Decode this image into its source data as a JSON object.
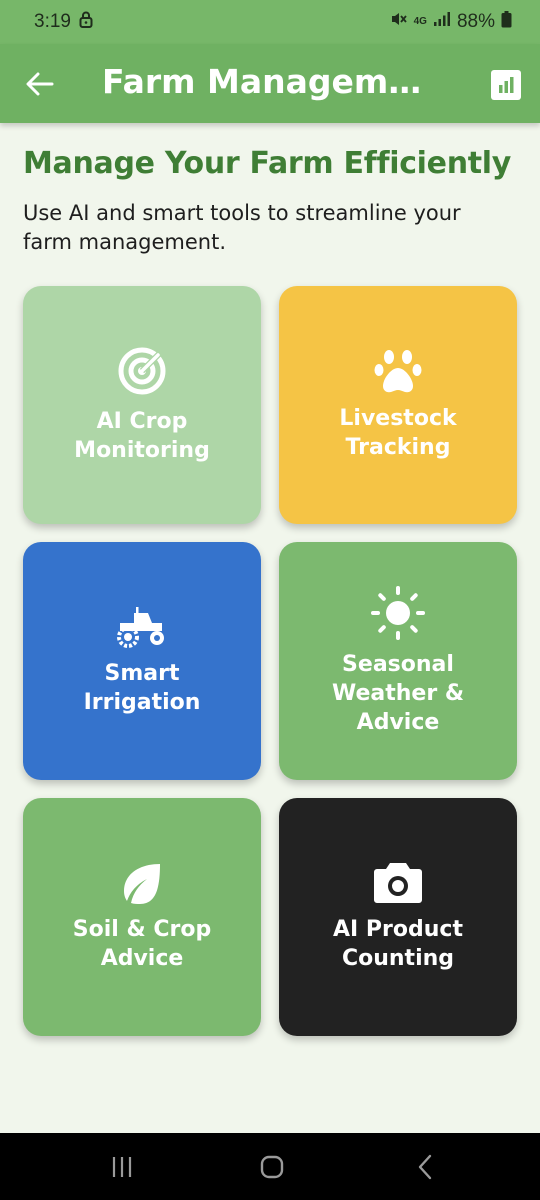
{
  "status_bar": {
    "time": "3:19",
    "network": "4G",
    "battery": "88%"
  },
  "app_bar": {
    "title": "Farm Management"
  },
  "headline": "Manage Your Farm Efficiently",
  "subtitle": "Use AI and smart tools to streamline your farm management.",
  "cards": [
    {
      "label": "AI Crop\nMonitoring",
      "icon": "radar-icon",
      "color": "#aed6a7"
    },
    {
      "label": "Livestock\nTracking",
      "icon": "paw-icon",
      "color": "#f5c445"
    },
    {
      "label": "Smart Irrigation",
      "icon": "tractor-icon",
      "color": "#3573cc"
    },
    {
      "label": "Seasonal\nWeather &\nAdvice",
      "icon": "sun-icon",
      "color": "#7cb96f"
    },
    {
      "label": "Soil & Crop\nAdvice",
      "icon": "leaf-icon",
      "color": "#7cb96f"
    },
    {
      "label": "AI Product\nCounting",
      "icon": "camera-icon",
      "color": "#222222"
    }
  ],
  "colors": {
    "app_bar": "#6fb162",
    "headline": "#3f7e35",
    "background": "#f1f6ec"
  }
}
